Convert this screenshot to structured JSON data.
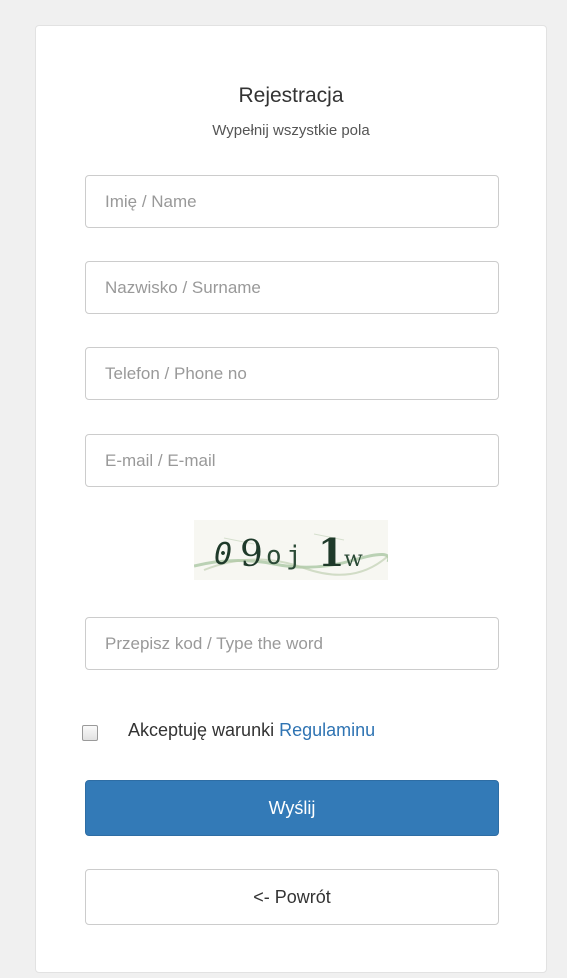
{
  "form": {
    "title": "Rejestracja",
    "subtitle": "Wypełnij wszystkie pola",
    "fields": {
      "name_placeholder": "Imię / Name",
      "surname_placeholder": "Nazwisko / Surname",
      "phone_placeholder": "Telefon / Phone no",
      "email_placeholder": "E-mail / E-mail",
      "captcha_placeholder": "Przepisz kod / Type the word"
    },
    "captcha": {
      "text": "09oj 1w"
    },
    "terms": {
      "label": "Akceptuję warunki ",
      "link_label": "Regulaminu",
      "checked": false
    },
    "submit_label": "Wyślij",
    "back_label": "<- Powrót"
  },
  "colors": {
    "primary": "#337ab7",
    "link": "#2f74b3",
    "background": "#f0f0f0"
  }
}
